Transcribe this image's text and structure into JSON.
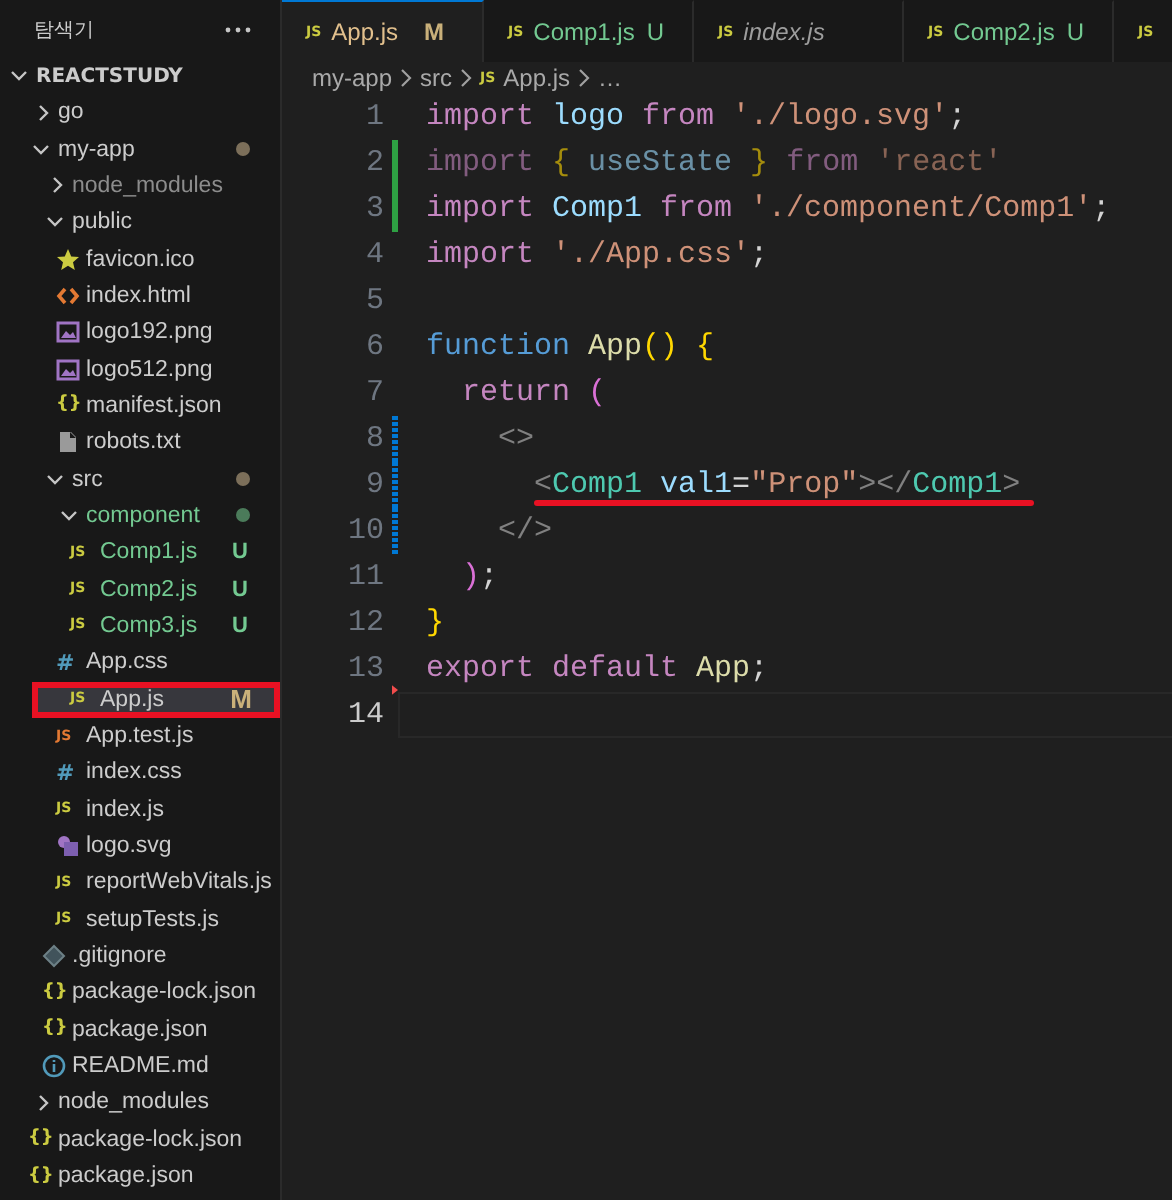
{
  "sidebar": {
    "title": "탐색기",
    "root": {
      "label": "REACTSTUDY",
      "expanded": true,
      "children": [
        {
          "label": "go",
          "kind": "folder",
          "expanded": false,
          "selected": false
        },
        {
          "label": "my-app",
          "kind": "folder",
          "expanded": true,
          "selected": false,
          "dot": {
            "color": "#7c6f5a"
          },
          "children": [
            {
              "label": "node_modules",
              "kind": "folder",
              "expanded": false,
              "selected": false,
              "color": "#8c8c8c"
            },
            {
              "label": "public",
              "kind": "folder",
              "expanded": true,
              "selected": false,
              "children": [
                {
                  "label": "favicon.ico",
                  "kind": "star",
                  "selected": false
                },
                {
                  "label": "index.html",
                  "kind": "html",
                  "selected": false
                },
                {
                  "label": "logo192.png",
                  "kind": "image",
                  "selected": false
                },
                {
                  "label": "logo512.png",
                  "kind": "image",
                  "selected": false
                },
                {
                  "label": "manifest.json",
                  "kind": "json",
                  "icon_text": "{}",
                  "selected": false
                },
                {
                  "label": "robots.txt",
                  "kind": "text",
                  "selected": false
                }
              ]
            },
            {
              "label": "src",
              "kind": "folder",
              "expanded": true,
              "selected": false,
              "dot": {
                "color": "#7c6f5a"
              },
              "children": [
                {
                  "label": "component",
                  "kind": "folder",
                  "expanded": true,
                  "selected": false,
                  "color": "#73c991",
                  "dot": {
                    "color": "#4b7b5a"
                  },
                  "children": [
                    {
                      "label": "Comp1.js",
                      "kind": "js",
                      "icon_text": "JS",
                      "selected": false,
                      "color": "#73c991",
                      "badge": {
                        "text": "U",
                        "color": "#73c991"
                      }
                    },
                    {
                      "label": "Comp2.js",
                      "kind": "js",
                      "icon_text": "JS",
                      "selected": false,
                      "color": "#73c991",
                      "badge": {
                        "text": "U",
                        "color": "#73c991"
                      }
                    },
                    {
                      "label": "Comp3.js",
                      "kind": "js",
                      "icon_text": "JS",
                      "selected": false,
                      "color": "#73c991",
                      "badge": {
                        "text": "U",
                        "color": "#73c991"
                      }
                    }
                  ]
                },
                {
                  "label": "App.css",
                  "kind": "css",
                  "icon_text": "#",
                  "selected": false
                },
                {
                  "label": "App.js",
                  "kind": "js",
                  "icon_text": "JS",
                  "selected": true,
                  "annotated": true,
                  "badge": {
                    "text": "M"
                  }
                },
                {
                  "label": "App.test.js",
                  "kind": "test",
                  "icon_text": "JS",
                  "selected": false
                },
                {
                  "label": "index.css",
                  "kind": "css",
                  "icon_text": "#",
                  "selected": false
                },
                {
                  "label": "index.js",
                  "kind": "js",
                  "icon_text": "JS",
                  "selected": false
                },
                {
                  "label": "logo.svg",
                  "kind": "svg",
                  "selected": false
                },
                {
                  "label": "reportWebVitals.js",
                  "kind": "js",
                  "icon_text": "JS",
                  "selected": false
                },
                {
                  "label": "setupTests.js",
                  "kind": "js",
                  "icon_text": "JS",
                  "selected": false
                }
              ]
            },
            {
              "label": ".gitignore",
              "kind": "git",
              "selected": false
            },
            {
              "label": "package-lock.json",
              "kind": "json",
              "icon_text": "{}",
              "selected": false
            },
            {
              "label": "package.json",
              "kind": "json",
              "icon_text": "{}",
              "selected": false
            },
            {
              "label": "README.md",
              "kind": "info",
              "selected": false
            }
          ]
        },
        {
          "label": "node_modules",
          "kind": "folder",
          "expanded": false,
          "selected": false
        },
        {
          "label": "package-lock.json",
          "kind": "json",
          "icon_text": "{}",
          "selected": false
        },
        {
          "label": "package.json",
          "kind": "json",
          "icon_text": "{}",
          "selected": false
        }
      ]
    }
  },
  "tabs": [
    {
      "icon_text": "JS",
      "label": "App.js",
      "color": "#e2c08d",
      "badge": {
        "text": "M",
        "color": "#c9b07a"
      },
      "selected": true,
      "preview": false
    },
    {
      "icon_text": "JS",
      "label": "Comp1.js",
      "color": "#73c991",
      "badge": {
        "text": "U",
        "color": "#73c991"
      },
      "selected": false,
      "preview": false
    },
    {
      "icon_text": "JS",
      "label": "index.js",
      "selected": false,
      "preview": true
    },
    {
      "icon_text": "JS",
      "label": "Comp2.js",
      "color": "#73c991",
      "badge": {
        "text": "U",
        "color": "#73c991"
      },
      "selected": false,
      "preview": false
    },
    {
      "icon_text": "JS",
      "selected": false
    }
  ],
  "breadcrumb": [
    {
      "label": "my-app"
    },
    {
      "label": "src"
    },
    {
      "label": "App.js",
      "icon_text": "JS"
    },
    {
      "label": "…"
    }
  ],
  "code": [
    {
      "number": "1",
      "kind": "plain",
      "tokens": [
        {
          "text": "import ",
          "kind": "keyword"
        },
        {
          "text": "logo ",
          "kind": "variable"
        },
        {
          "text": "from ",
          "kind": "keyword"
        },
        {
          "text": "'./logo.svg'",
          "kind": "string"
        },
        {
          "text": ";",
          "kind": "plain"
        }
      ]
    },
    {
      "number": "2",
      "kind": "added",
      "dim": true,
      "tokens": [
        {
          "text": "import ",
          "kind": "keyword"
        },
        {
          "text": "{ ",
          "kind": "brace"
        },
        {
          "text": "useState ",
          "kind": "variable"
        },
        {
          "text": "} ",
          "kind": "brace"
        },
        {
          "text": "from ",
          "kind": "keyword"
        },
        {
          "text": "'react'",
          "kind": "string"
        }
      ]
    },
    {
      "number": "3",
      "kind": "added",
      "tokens": [
        {
          "text": "import ",
          "kind": "keyword"
        },
        {
          "text": "Comp1 ",
          "kind": "variable"
        },
        {
          "text": "from ",
          "kind": "keyword"
        },
        {
          "text": "'./component/Comp1'",
          "kind": "string"
        },
        {
          "text": ";",
          "kind": "plain"
        }
      ]
    },
    {
      "number": "4",
      "kind": "plain",
      "tokens": [
        {
          "text": "import ",
          "kind": "keyword"
        },
        {
          "text": "'./App.css'",
          "kind": "string"
        },
        {
          "text": ";",
          "kind": "plain"
        }
      ]
    },
    {
      "number": "5",
      "kind": "plain"
    },
    {
      "number": "6",
      "kind": "plain",
      "tokens": [
        {
          "text": "function ",
          "kind": "storage"
        },
        {
          "text": "App",
          "kind": "function"
        },
        {
          "text": "() {",
          "kind": "brace"
        }
      ]
    },
    {
      "number": "7",
      "kind": "plain",
      "tokens": [
        {
          "text": "  return ",
          "kind": "keyword"
        },
        {
          "text": "(",
          "kind": "paren"
        }
      ]
    },
    {
      "number": "8",
      "kind": "modified",
      "tokens": [
        {
          "text": "    <>",
          "kind": "punctuation"
        }
      ]
    },
    {
      "number": "9",
      "kind": "modified",
      "annotated": true,
      "tokens": [
        {
          "text": "      <",
          "kind": "punctuation"
        },
        {
          "text": "Comp1 ",
          "kind": "tag"
        },
        {
          "text": "val1",
          "kind": "variable"
        },
        {
          "text": "=",
          "kind": "plain"
        },
        {
          "text": "\"Prop\"",
          "kind": "string"
        },
        {
          "text": "></",
          "kind": "punctuation"
        },
        {
          "text": "Comp1",
          "kind": "tag"
        },
        {
          "text": ">",
          "kind": "punctuation"
        }
      ]
    },
    {
      "number": "10",
      "kind": "modified",
      "tokens": [
        {
          "text": "    </>",
          "kind": "punctuation"
        }
      ]
    },
    {
      "number": "11",
      "kind": "plain",
      "tokens": [
        {
          "text": "  )",
          "kind": "paren"
        },
        {
          "text": ";",
          "kind": "plain"
        }
      ]
    },
    {
      "number": "12",
      "kind": "plain",
      "tokens": [
        {
          "text": "}",
          "kind": "brace"
        }
      ]
    },
    {
      "number": "13",
      "kind": "deleted",
      "tokens": [
        {
          "text": "export ",
          "kind": "keyword"
        },
        {
          "text": "default ",
          "kind": "keyword"
        },
        {
          "text": "App",
          "kind": "function"
        },
        {
          "text": ";",
          "kind": "plain"
        }
      ]
    },
    {
      "number": "14",
      "kind": "plain",
      "current": true
    }
  ]
}
